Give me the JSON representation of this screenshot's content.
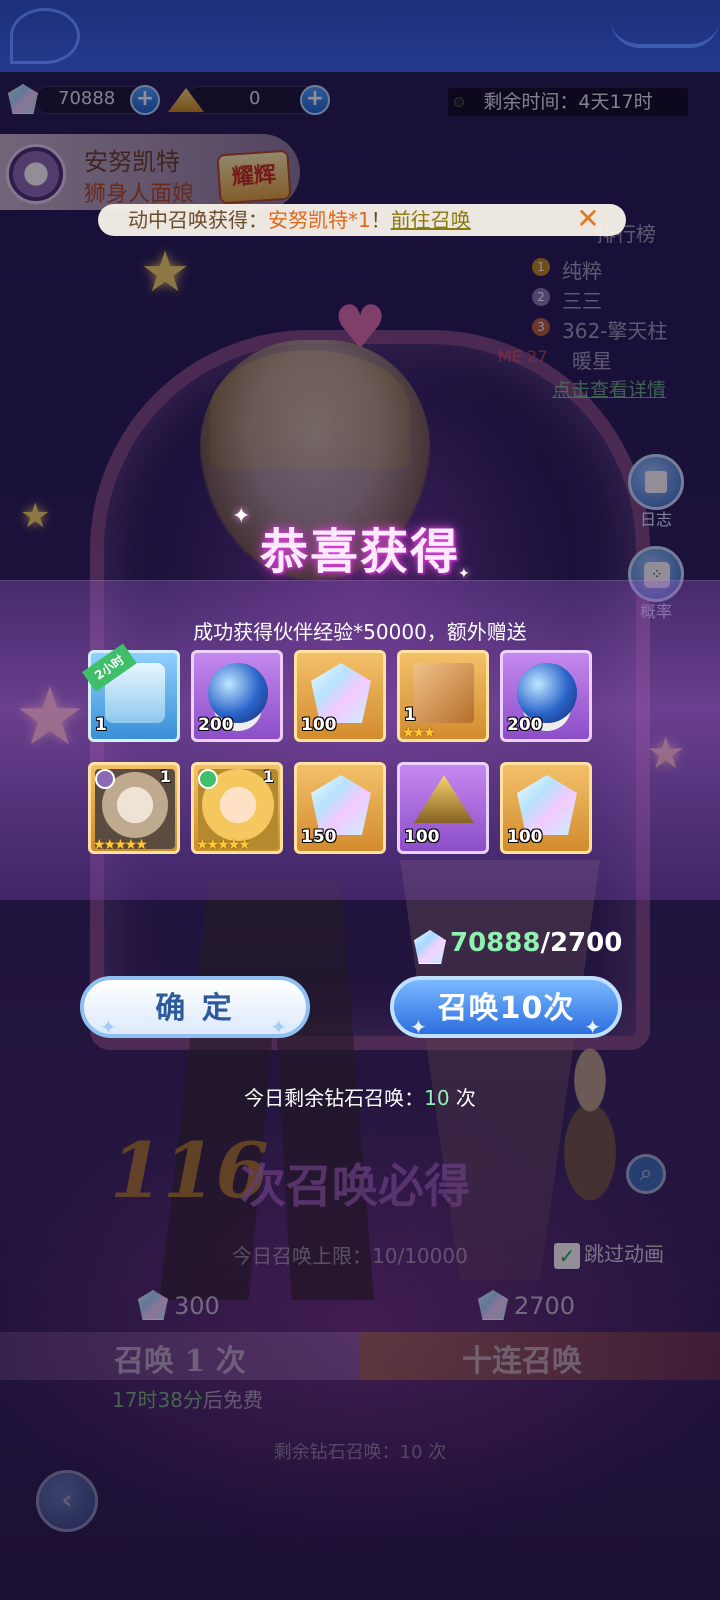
{
  "currency": {
    "diamonds": "70888",
    "gold": "0"
  },
  "timer": "剩余时间：4天17时",
  "hero_banner": {
    "name": "安努凯特",
    "title": "狮身人面娘",
    "rank": "耀辉"
  },
  "notice": {
    "prefix": "动中召唤获得：",
    "hero": "安努凯特*1",
    "sep": "！",
    "link": "前往召唤"
  },
  "leaderboard": {
    "title": "排行榜",
    "entries": [
      {
        "rank": "1",
        "name": "纯粹"
      },
      {
        "rank": "2",
        "name": "三三"
      },
      {
        "rank": "3",
        "name": "362-擎天柱"
      }
    ],
    "me_label": "ME",
    "me_rank": "27",
    "me_name": "暖星",
    "details_link": "点击查看详情"
  },
  "side_buttons": {
    "log": "日志",
    "probability": "概率"
  },
  "result": {
    "title": "恭喜获得",
    "description": "成功获得伙伴经验*50000，额外赠送",
    "items": [
      {
        "type": "chest",
        "qty": "1",
        "ribbon": "2小时",
        "bg": "blue-bg"
      },
      {
        "type": "orb",
        "qty": "200",
        "bg": "purple-bg"
      },
      {
        "type": "gem",
        "qty": "100",
        "bg": "gold-bg"
      },
      {
        "type": "box",
        "qty": "1",
        "stars": "★★★",
        "bg": "gold-bg"
      },
      {
        "type": "orb",
        "qty": "200",
        "bg": "purple-bg"
      },
      {
        "type": "portrait-1",
        "qty": "1",
        "stars": "★★★★★",
        "bg": "gold-bg"
      },
      {
        "type": "portrait-2",
        "qty": "1",
        "stars": "★★★★★",
        "bg": "gold-bg"
      },
      {
        "type": "gem",
        "qty": "150",
        "bg": "gold-bg"
      },
      {
        "type": "pyramid",
        "qty": "100",
        "bg": "purple-bg"
      },
      {
        "type": "gem",
        "qty": "100",
        "bg": "gold-bg"
      }
    ]
  },
  "cost": {
    "have": "70888",
    "need": "/2700"
  },
  "buttons": {
    "confirm": "确 定",
    "summon10": "召唤10次"
  },
  "remain_today": {
    "prefix": "今日剩余钻石召唤：",
    "count": "10",
    "suffix": " 次"
  },
  "pity": {
    "number": "116",
    "text": "次召唤必得"
  },
  "limit": {
    "prefix": "今日召唤上限：",
    "value": "10/10000"
  },
  "skip_animation": "跳过动画",
  "summon_once": {
    "cost": "300",
    "label": "召唤 1 次"
  },
  "summon_ten": {
    "cost": "2700",
    "label": "十连召唤"
  },
  "free_line": {
    "time": "17时38分",
    "suffix": "后免费"
  },
  "bottom_remain": {
    "prefix": "剩余钻石召唤：",
    "count": "10",
    "suffix": " 次"
  },
  "icons": [
    "gem-icon",
    "gold-icon",
    "plus-icon",
    "moon-icon",
    "close-icon",
    "log-icon",
    "dice-icon",
    "back-icon",
    "magnify-icon",
    "check-icon"
  ],
  "colors": {
    "accent_blue": "#2c6fe0",
    "highlight_green": "#8ff2b0",
    "title_pink": "#ffe9ff",
    "notice_orange": "#e06818"
  }
}
